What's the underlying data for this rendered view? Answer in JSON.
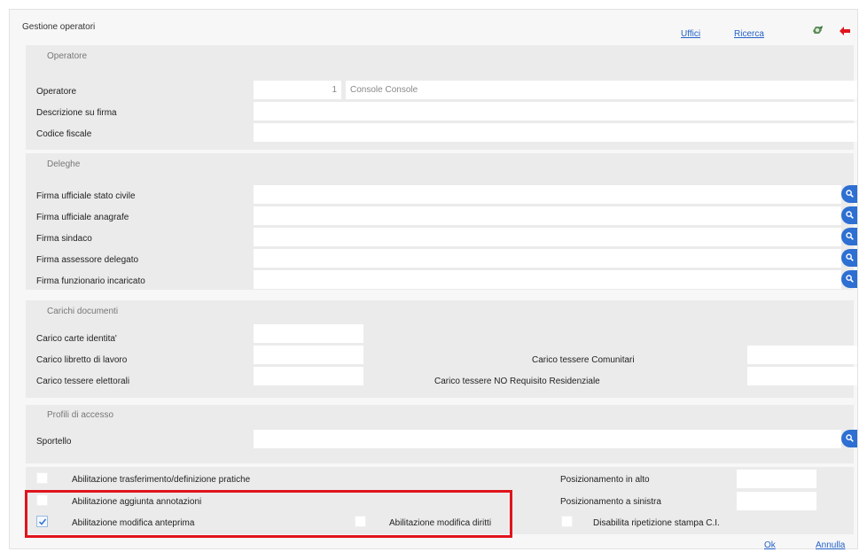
{
  "header": {
    "title": "Gestione operatori",
    "uffici_label": "Uffici",
    "ricerca_label": "Ricerca"
  },
  "operatore": {
    "section_title": "Operatore",
    "operatore_label": "Operatore",
    "operatore_code": "1",
    "operatore_name": "Console Console",
    "descrizione_label": "Descrizione su firma",
    "descrizione_value": "",
    "codice_fiscale_label": "Codice fiscale",
    "codice_fiscale_value": ""
  },
  "deleghe": {
    "section_title": "Deleghe",
    "items": [
      {
        "label": "Firma ufficiale stato civile",
        "value": ""
      },
      {
        "label": "Firma ufficiale anagrafe",
        "value": ""
      },
      {
        "label": "Firma sindaco",
        "value": ""
      },
      {
        "label": "Firma assessore delegato",
        "value": ""
      },
      {
        "label": "Firma funzionario incaricato",
        "value": ""
      }
    ]
  },
  "carichi": {
    "section_title": "Carichi documenti",
    "carte_identita_label": "Carico carte identita'",
    "libretto_label": "Carico libretto di lavoro",
    "elettorali_label": "Carico tessere elettorali",
    "comunitari_label": "Carico tessere Comunitari",
    "no_requisito_label": "Carico tessere NO Requisito Residenziale"
  },
  "profili": {
    "section_title": "Profili di accesso",
    "sportello_label": "Sportello",
    "sportello_value": ""
  },
  "abilitazioni": {
    "trasferimento_label": "Abilitazione trasferimento/definizione pratiche",
    "annotazioni_label": "Abilitazione aggiunta annotazioni",
    "anteprima_label": "Abilitazione modifica anteprima",
    "diritti_label": "Abilitazione modifica diritti",
    "posizionamento_alto_label": "Posizionamento in alto",
    "posizionamento_sinistra_label": "Posizionamento a sinistra",
    "disabilita_stampa_label": "Disabilita ripetizione stampa C.I."
  },
  "footer": {
    "ok_label": "Ok",
    "annulla_label": "Annulla"
  },
  "colors": {
    "accent": "#2d6fd2",
    "link": "#2563c9",
    "highlight": "#e0141d",
    "panel": "#ebebeb"
  }
}
